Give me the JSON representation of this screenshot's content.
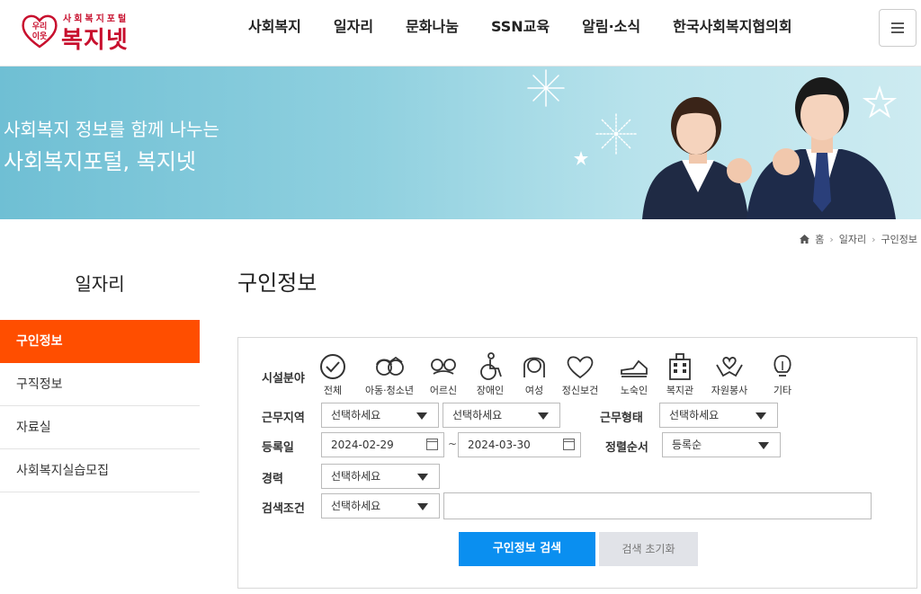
{
  "header": {
    "logo_small": "사회복지포털",
    "logo_big": "복지넷",
    "logo_heart": "우리이웃",
    "nav": [
      "사회복지",
      "일자리",
      "문화나눔",
      "SSN교육",
      "알림·소식",
      "한국사회복지협의회"
    ],
    "menu_icon": "hamburger-icon"
  },
  "banner": {
    "line1": "사회복지 정보를 함께 나누는",
    "line2": "사회복지포털, 복지넷"
  },
  "breadcrumb": {
    "home": "홈",
    "level1": "일자리",
    "level2": "구인정보"
  },
  "sidebar": {
    "title": "일자리",
    "items": [
      "구인정보",
      "구직정보",
      "자료실",
      "사회복지실습모집"
    ]
  },
  "main": {
    "title": "구인정보",
    "search": {
      "facility_label": "시설분야",
      "categories": [
        {
          "label": "전체",
          "icon": "check-circle-icon"
        },
        {
          "label": "아동·청소년",
          "icon": "children-icon"
        },
        {
          "label": "어르신",
          "icon": "elder-glasses-icon"
        },
        {
          "label": "장애인",
          "icon": "wheelchair-icon"
        },
        {
          "label": "여성",
          "icon": "woman-icon"
        },
        {
          "label": "정신보건",
          "icon": "heart-icon"
        },
        {
          "label": "노숙인",
          "icon": "shoe-icon"
        },
        {
          "label": "복지관",
          "icon": "building-icon"
        },
        {
          "label": "자원봉사",
          "icon": "hands-heart-icon"
        },
        {
          "label": "기타",
          "icon": "lightbulb-icon"
        }
      ],
      "region_label": "근무지역",
      "region1": "선택하세요",
      "region2": "선택하세요",
      "worktype_label": "근무형태",
      "worktype": "선택하세요",
      "date_label": "등록일",
      "date_from": "2024-02-29",
      "date_to": "2024-03-30",
      "date_sep": "~",
      "sort_label": "정렬순서",
      "sort": "등록순",
      "career_label": "경력",
      "career": "선택하세요",
      "condition_label": "검색조건",
      "condition": "선택하세요",
      "keyword": "",
      "search_button": "구인정보 검색",
      "reset_button": "검색 초기화"
    }
  },
  "colors": {
    "brand": "#c8102e",
    "active_menu": "#ff4e00",
    "search_button": "#0a8ff0"
  }
}
